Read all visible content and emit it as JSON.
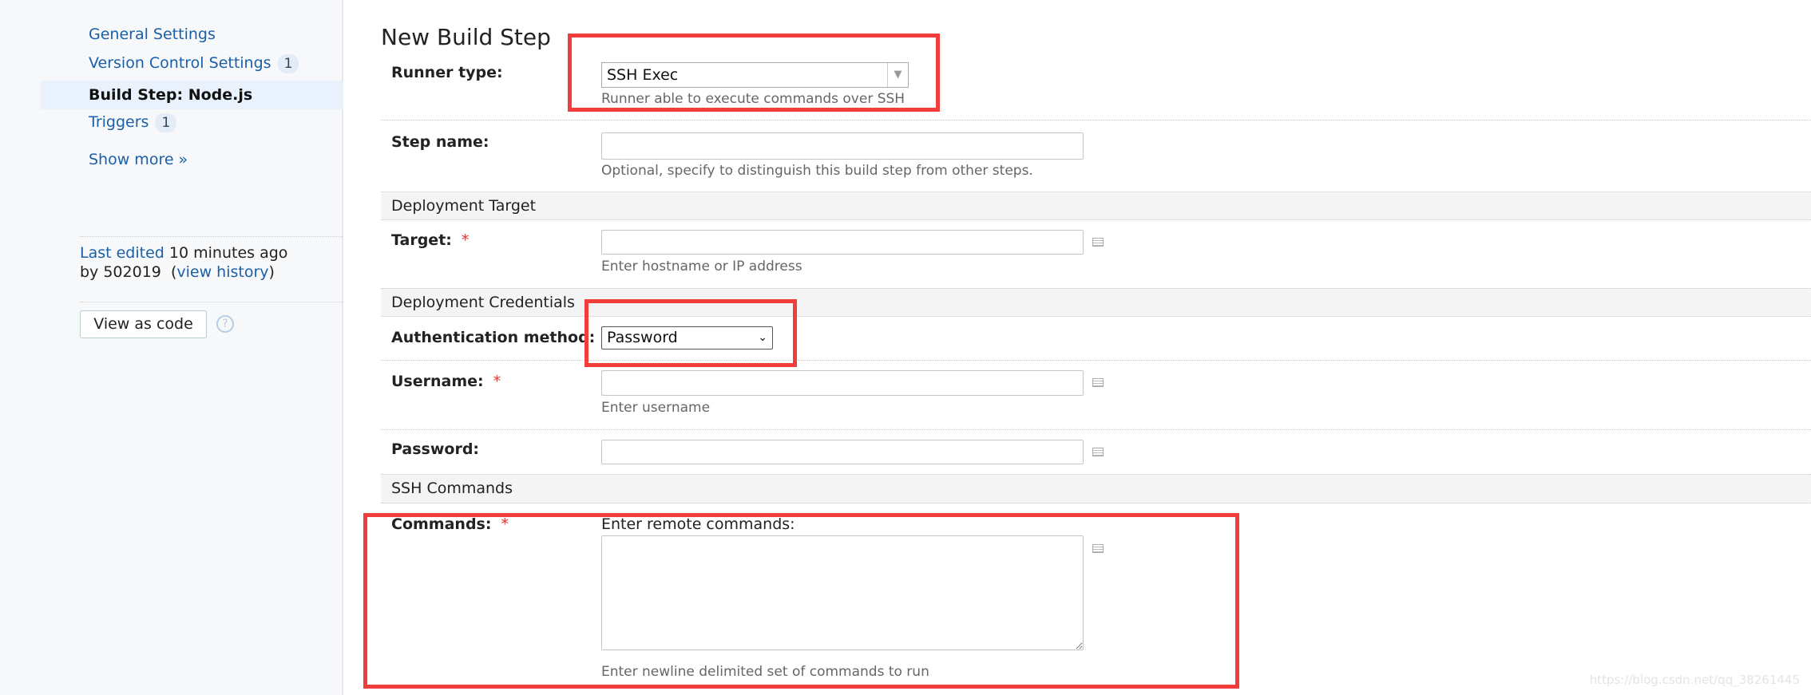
{
  "sidebar": {
    "items": [
      {
        "label": "General Settings"
      },
      {
        "label": "Version Control Settings",
        "badge": "1"
      },
      {
        "label": "Build Step: Node.js",
        "active": true
      },
      {
        "label": "Triggers",
        "badge": "1"
      }
    ],
    "show_more": "Show more »",
    "last_edited_link": "Last edited",
    "last_edited_time": "10 minutes ago",
    "by_user": "by 502019",
    "view_history": "view history",
    "view_as_code": "View as code",
    "help": "?"
  },
  "main": {
    "title": "New Build Step",
    "runner_type": {
      "label": "Runner type:",
      "value": "SSH Exec",
      "hint": "Runner able to execute commands over SSH"
    },
    "step_name": {
      "label": "Step name:",
      "value": "",
      "hint": "Optional, specify to distinguish this build step from other steps."
    },
    "section_target": "Deployment Target",
    "target": {
      "label": "Target:",
      "required": "*",
      "value": "",
      "hint": "Enter hostname or IP address"
    },
    "section_credentials": "Deployment Credentials",
    "auth_method": {
      "label": "Authentication method:",
      "value": "Password"
    },
    "username": {
      "label": "Username:",
      "required": "*",
      "value": "",
      "hint": "Enter username"
    },
    "password": {
      "label": "Password:",
      "value": ""
    },
    "section_ssh": "SSH Commands",
    "commands": {
      "label": "Commands:",
      "required": "*",
      "caption": "Enter remote commands:",
      "value": "",
      "hint": "Enter newline delimited set of commands to run"
    }
  },
  "annotation_color": "#f23d3d",
  "watermark": "https://blog.csdn.net/qq_38261445"
}
